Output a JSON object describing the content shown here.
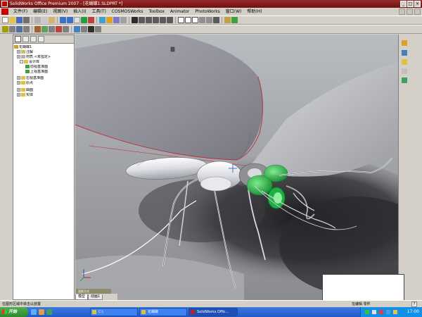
{
  "window": {
    "title": "SolidWorks Office Premium 2007 - [花蝴蝶1.SLDPRT *]"
  },
  "menu": [
    "文件(F)",
    "编辑(E)",
    "视图(V)",
    "插入(I)",
    "工具(T)",
    "COSMOSWorks",
    "Toolbox",
    "Animator",
    "PhotoWorks",
    "窗口(W)",
    "帮助(H)"
  ],
  "colors": {
    "title_bar": "#8a1c1c",
    "wing_outline": "#c0283a",
    "eye_green": "#23b84a",
    "taskbar_blue": "#2458c8"
  },
  "feature_tree": {
    "items": [
      {
        "label": "花蝴蝶1",
        "icon": "part-icon"
      },
      {
        "label": "注解",
        "icon": "annotation-icon"
      },
      {
        "label": "材质 <未指定>",
        "icon": "material-icon"
      },
      {
        "label": "设计库",
        "icon": "folder-icon"
      },
      {
        "label": "前视基准面",
        "icon": "plane-icon"
      },
      {
        "label": "上视基准面",
        "icon": "plane-icon"
      },
      {
        "label": "右视基准面",
        "icon": "plane-icon"
      },
      {
        "label": "原点",
        "icon": "origin-icon"
      },
      {
        "label": "曲面",
        "icon": "surface-icon"
      },
      {
        "label": "实体",
        "icon": "body-icon"
      }
    ]
  },
  "model_tabs": [
    "模型",
    "动画1"
  ],
  "controls_label": "观察方式",
  "status_bar": {
    "left": "在图形区域中单击以放置",
    "right": "在编辑 零件"
  },
  "taskbar": {
    "start_label": "开始",
    "tasks": [
      {
        "label": "C:\\",
        "icon": "explorer-icon"
      },
      {
        "label": "花蝴蝶",
        "icon": "folder-icon"
      },
      {
        "label": "SolidWorks Offic...",
        "icon": "solidworks-icon"
      }
    ],
    "clock": "17:00"
  }
}
